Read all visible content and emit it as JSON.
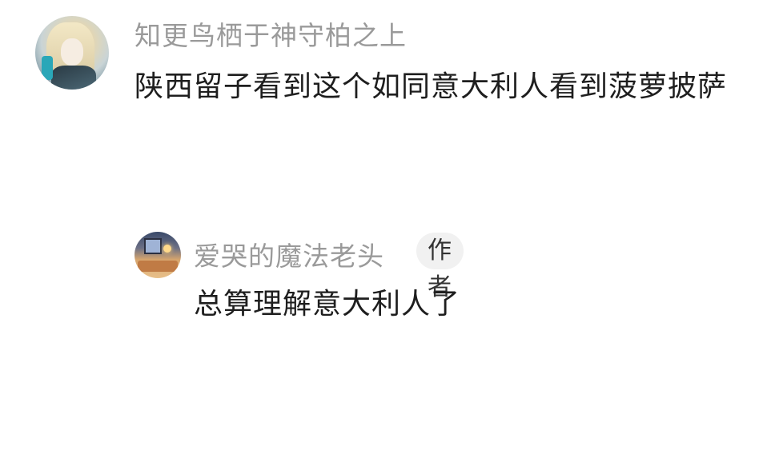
{
  "comments": [
    {
      "username": "知更鸟栖于神守柏之上",
      "text": "陕西留子看到这个如同意大利人看到菠萝披萨",
      "avatar": "anime-character-avatar"
    },
    {
      "username": "爱哭的魔法老头",
      "badge": "作者",
      "text": "总算理解意大利人了",
      "avatar": "illustrated-room-avatar"
    }
  ]
}
